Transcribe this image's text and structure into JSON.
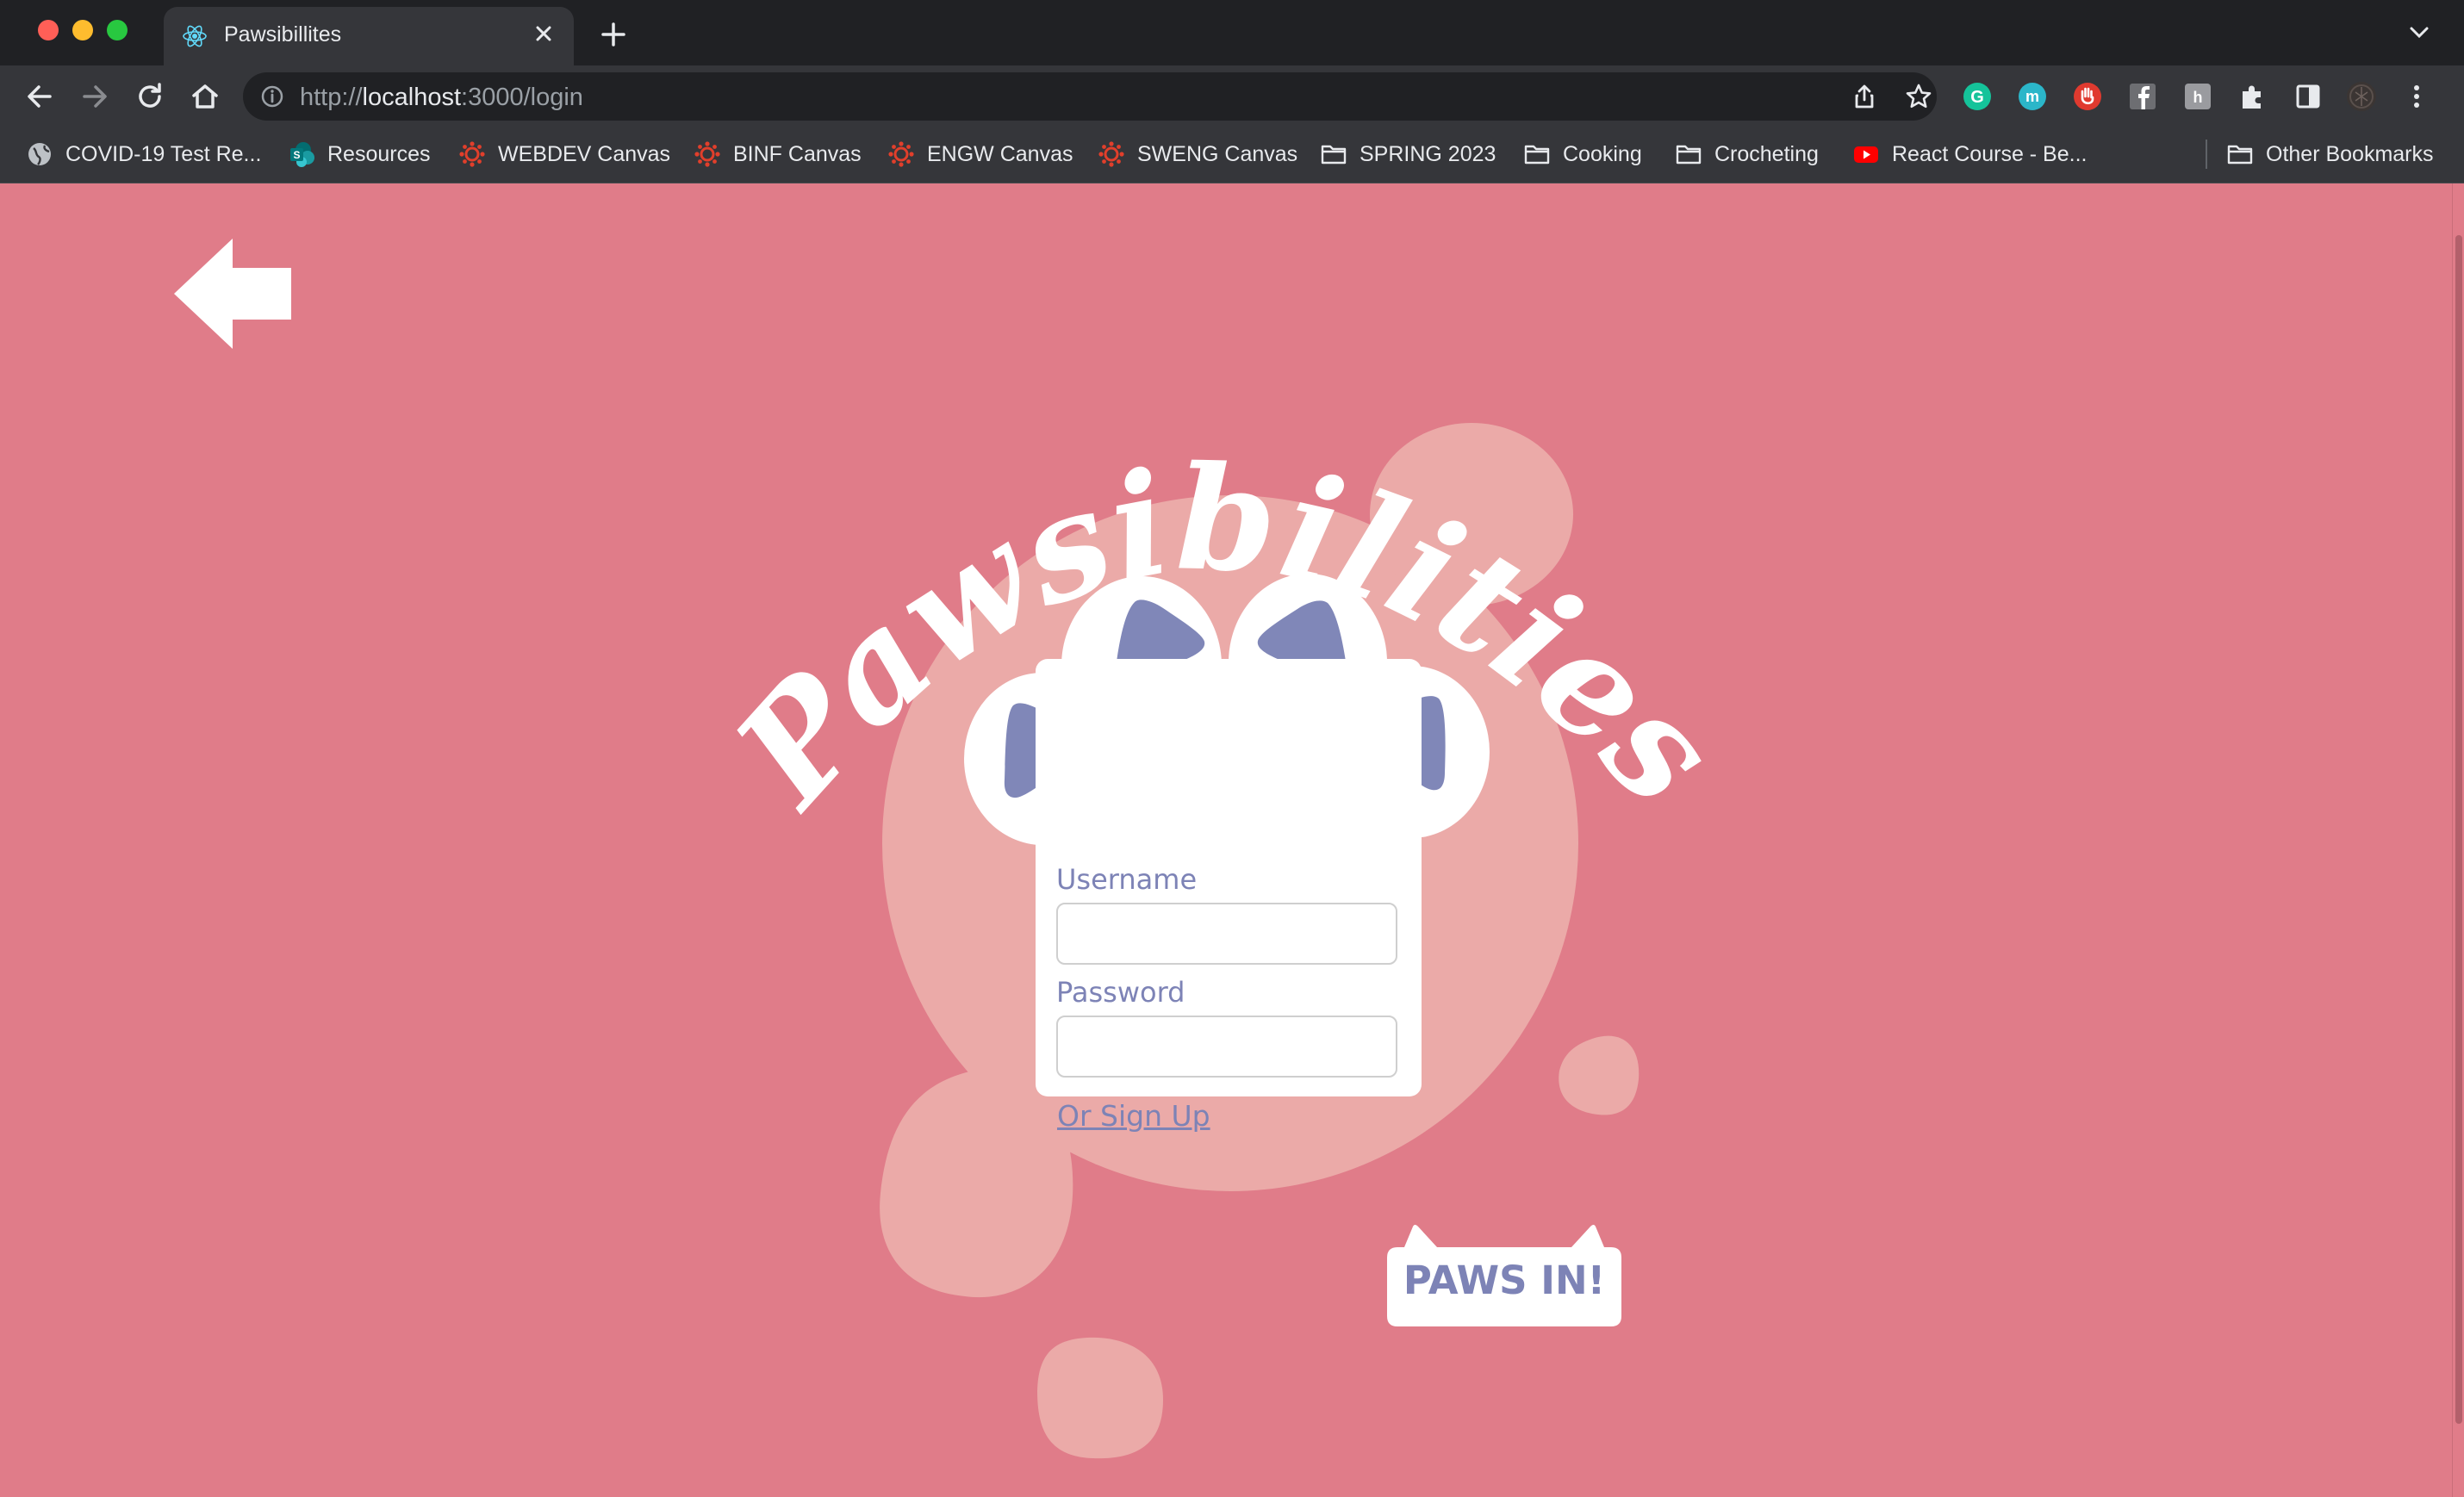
{
  "browser": {
    "tab_title": "Pawsibillites",
    "url_scheme": "http://",
    "url_host": "localhost",
    "url_rest": ":3000/login"
  },
  "bookmarks": [
    {
      "label": "COVID-19 Test Re...",
      "icon": "globe-icon"
    },
    {
      "label": "Resources",
      "icon": "sharepoint-icon"
    },
    {
      "label": "WEBDEV Canvas",
      "icon": "canvas-icon"
    },
    {
      "label": "BINF Canvas",
      "icon": "canvas-icon"
    },
    {
      "label": "ENGW Canvas",
      "icon": "canvas-icon"
    },
    {
      "label": "SWENG Canvas",
      "icon": "canvas-icon"
    },
    {
      "label": "SPRING 2023",
      "icon": "folder-icon"
    },
    {
      "label": "Cooking",
      "icon": "folder-icon"
    },
    {
      "label": "Crocheting",
      "icon": "folder-icon"
    },
    {
      "label": "React Course - Be...",
      "icon": "youtube-icon"
    },
    {
      "label": "Other Bookmarks",
      "icon": "folder-icon"
    }
  ],
  "page": {
    "logo_text": "Pawsibilities",
    "login": {
      "username_label": "Username",
      "username_value": "",
      "password_label": "Password",
      "password_value": "",
      "signup_link": "Or Sign Up",
      "submit_label": "PAWS IN!"
    }
  },
  "colors": {
    "background": "#e07c89",
    "blob": "#ebaaa8",
    "accent": "#7d83b6",
    "card": "#ffffff"
  }
}
